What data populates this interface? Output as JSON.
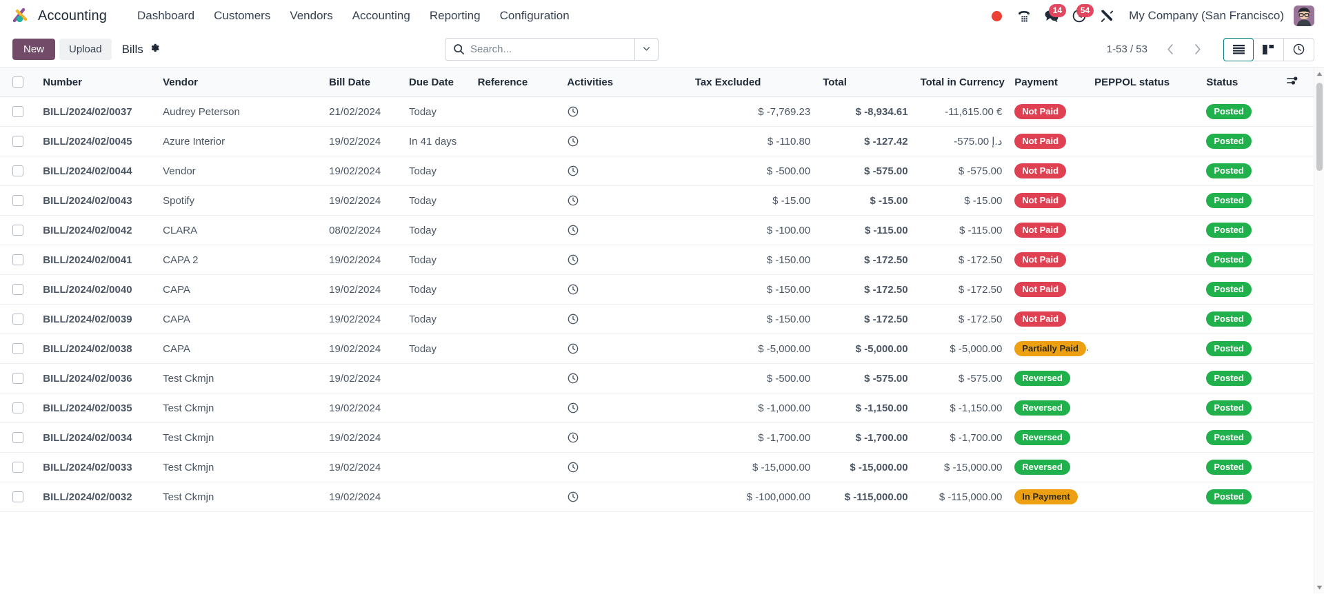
{
  "navbar": {
    "brand": "Accounting",
    "menu": [
      "Dashboard",
      "Customers",
      "Vendors",
      "Accounting",
      "Reporting",
      "Configuration"
    ],
    "systray": {
      "recording_dot": "recording-indicator",
      "phone": "phone-dialpad-icon",
      "messages_badge": "14",
      "activities_badge": "54",
      "tools": "wrench-screwdriver-icon"
    },
    "company": "My Company (San Francisco)",
    "avatar": "user-avatar"
  },
  "control_panel": {
    "new_label": "New",
    "upload_label": "Upload",
    "breadcrumb": "Bills",
    "settings_icon": "gear-icon",
    "search_placeholder": "Search...",
    "pager": "1-53 / 53",
    "views": [
      {
        "name": "list",
        "active": true
      },
      {
        "name": "kanban",
        "active": false
      },
      {
        "name": "activity",
        "active": false
      }
    ]
  },
  "table": {
    "columns": [
      "Number",
      "Vendor",
      "Bill Date",
      "Due Date",
      "Reference",
      "Activities",
      "Tax Excluded",
      "Total",
      "Total in Currency",
      "Payment",
      "PEPPOL status",
      "Status"
    ],
    "rows": [
      {
        "number": "BILL/2024/02/0037",
        "vendor": "Audrey Peterson",
        "bill_date": "21/02/2024",
        "due_date": "Today",
        "due_style": "today",
        "reference": "",
        "tax_excluded": "$ -7,769.23",
        "total": "$ -8,934.61",
        "total_currency": "-11,615.00 €",
        "payment": "Not Paid",
        "payment_style": "notpaid",
        "peppol": "",
        "status": "Posted"
      },
      {
        "number": "BILL/2024/02/0045",
        "vendor": "Azure Interior",
        "bill_date": "19/02/2024",
        "due_date": "In 41 days",
        "due_style": "plain",
        "reference": "",
        "tax_excluded": "$ -110.80",
        "total": "$ -127.42",
        "total_currency": "-575.00 د.إ",
        "payment": "Not Paid",
        "payment_style": "notpaid",
        "peppol": "",
        "status": "Posted"
      },
      {
        "number": "BILL/2024/02/0044",
        "vendor": "Vendor",
        "bill_date": "19/02/2024",
        "due_date": "Today",
        "due_style": "today",
        "reference": "",
        "tax_excluded": "$ -500.00",
        "total": "$ -575.00",
        "total_currency": "$ -575.00",
        "payment": "Not Paid",
        "payment_style": "notpaid",
        "peppol": "",
        "status": "Posted"
      },
      {
        "number": "BILL/2024/02/0043",
        "vendor": "Spotify",
        "bill_date": "19/02/2024",
        "due_date": "Today",
        "due_style": "today",
        "reference": "",
        "tax_excluded": "$ -15.00",
        "total": "$ -15.00",
        "total_currency": "$ -15.00",
        "payment": "Not Paid",
        "payment_style": "notpaid",
        "peppol": "",
        "status": "Posted"
      },
      {
        "number": "BILL/2024/02/0042",
        "vendor": "CLARA",
        "bill_date": "08/02/2024",
        "due_date": "Today",
        "due_style": "today",
        "reference": "",
        "tax_excluded": "$ -100.00",
        "total": "$ -115.00",
        "total_currency": "$ -115.00",
        "payment": "Not Paid",
        "payment_style": "notpaid",
        "peppol": "",
        "status": "Posted"
      },
      {
        "number": "BILL/2024/02/0041",
        "vendor": "CAPA 2",
        "bill_date": "19/02/2024",
        "due_date": "Today",
        "due_style": "today",
        "reference": "",
        "tax_excluded": "$ -150.00",
        "total": "$ -172.50",
        "total_currency": "$ -172.50",
        "payment": "Not Paid",
        "payment_style": "notpaid",
        "peppol": "",
        "status": "Posted"
      },
      {
        "number": "BILL/2024/02/0040",
        "vendor": "CAPA",
        "bill_date": "19/02/2024",
        "due_date": "Today",
        "due_style": "today",
        "reference": "",
        "tax_excluded": "$ -150.00",
        "total": "$ -172.50",
        "total_currency": "$ -172.50",
        "payment": "Not Paid",
        "payment_style": "notpaid",
        "peppol": "",
        "status": "Posted"
      },
      {
        "number": "BILL/2024/02/0039",
        "vendor": "CAPA",
        "bill_date": "19/02/2024",
        "due_date": "Today",
        "due_style": "today",
        "reference": "",
        "tax_excluded": "$ -150.00",
        "total": "$ -172.50",
        "total_currency": "$ -172.50",
        "payment": "Not Paid",
        "payment_style": "notpaid",
        "peppol": "",
        "status": "Posted"
      },
      {
        "number": "BILL/2024/02/0038",
        "vendor": "CAPA",
        "bill_date": "19/02/2024",
        "due_date": "Today",
        "due_style": "today",
        "reference": "",
        "tax_excluded": "$ -5,000.00",
        "total": "$ -5,000.00",
        "total_currency": "$ -5,000.00",
        "payment": "Partially Paid",
        "payment_style": "partial",
        "peppol": "",
        "status": "Posted"
      },
      {
        "number": "BILL/2024/02/0036",
        "vendor": "Test Ckmjn",
        "bill_date": "19/02/2024",
        "due_date": "",
        "due_style": "plain",
        "reference": "",
        "tax_excluded": "$ -500.00",
        "total": "$ -575.00",
        "total_currency": "$ -575.00",
        "payment": "Reversed",
        "payment_style": "reversed",
        "peppol": "",
        "status": "Posted"
      },
      {
        "number": "BILL/2024/02/0035",
        "vendor": "Test Ckmjn",
        "bill_date": "19/02/2024",
        "due_date": "",
        "due_style": "plain",
        "reference": "",
        "tax_excluded": "$ -1,000.00",
        "total": "$ -1,150.00",
        "total_currency": "$ -1,150.00",
        "payment": "Reversed",
        "payment_style": "reversed",
        "peppol": "",
        "status": "Posted"
      },
      {
        "number": "BILL/2024/02/0034",
        "vendor": "Test Ckmjn",
        "bill_date": "19/02/2024",
        "due_date": "",
        "due_style": "plain",
        "reference": "",
        "tax_excluded": "$ -1,700.00",
        "total": "$ -1,700.00",
        "total_currency": "$ -1,700.00",
        "payment": "Reversed",
        "payment_style": "reversed",
        "peppol": "",
        "status": "Posted"
      },
      {
        "number": "BILL/2024/02/0033",
        "vendor": "Test Ckmjn",
        "bill_date": "19/02/2024",
        "due_date": "",
        "due_style": "plain",
        "reference": "",
        "tax_excluded": "$ -15,000.00",
        "total": "$ -15,000.00",
        "total_currency": "$ -15,000.00",
        "payment": "Reversed",
        "payment_style": "reversed",
        "peppol": "",
        "status": "Posted"
      },
      {
        "number": "BILL/2024/02/0032",
        "vendor": "Test Ckmjn",
        "bill_date": "19/02/2024",
        "due_date": "",
        "due_style": "plain",
        "reference": "",
        "tax_excluded": "$ -100,000.00",
        "total": "$ -115,000.00",
        "total_currency": "$ -115,000.00",
        "payment": "In Payment",
        "payment_style": "inpayment",
        "peppol": "",
        "status": "Posted"
      }
    ]
  }
}
